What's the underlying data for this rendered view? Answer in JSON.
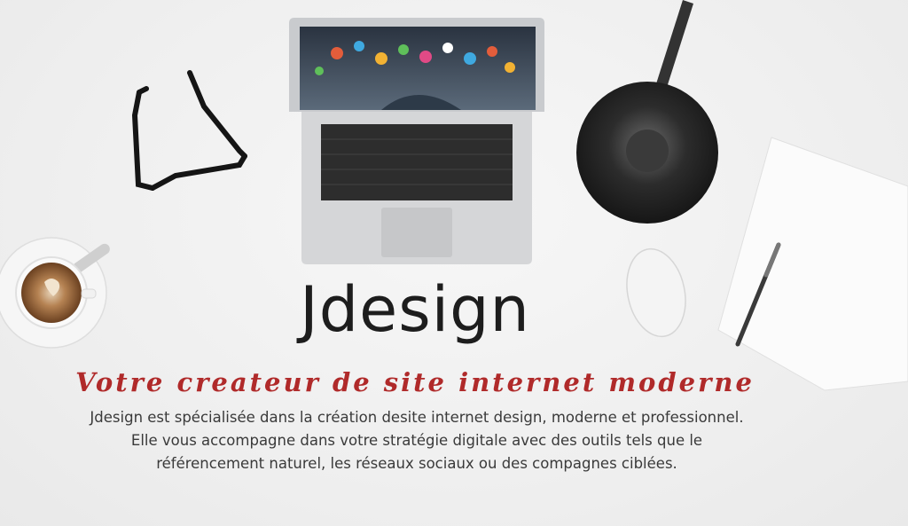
{
  "hero": {
    "title": "Jdesign",
    "tagline": "Votre createur de site internet moderne",
    "description": "Jdesign est spécialisée dans la création desite internet design, moderne et professionnel. Elle vous accompagne dans votre stratégie digitale avec des outils tels que le référencement naturel, les réseaux sociaux ou des compagnes ciblées."
  },
  "colors": {
    "background": "#f1f1f1",
    "tagline": "#b02a2a",
    "title": "#1d1d1d",
    "body_text": "#3a3a3a"
  }
}
